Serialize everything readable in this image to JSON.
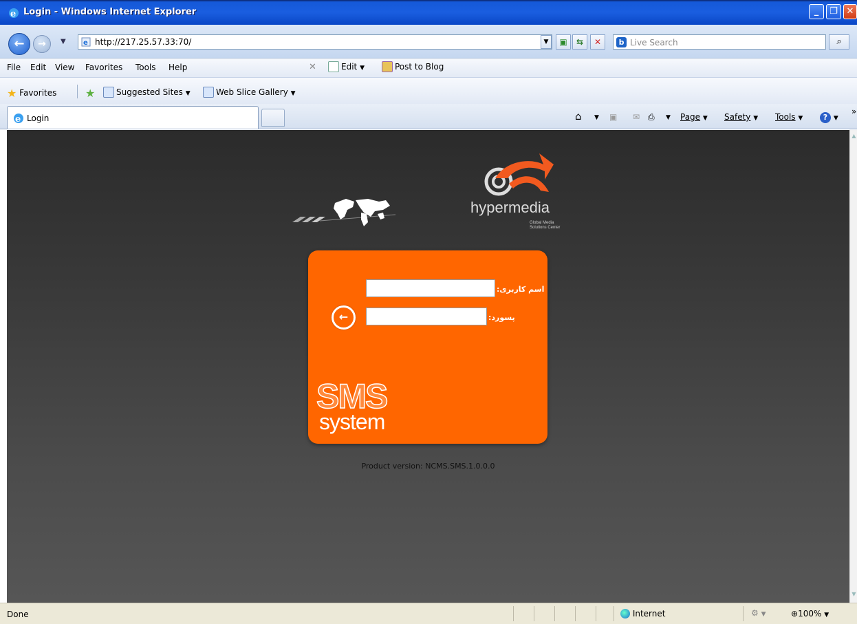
{
  "window": {
    "title": "Login - Windows Internet Explorer"
  },
  "address": {
    "url": "http://217.25.57.33:70/",
    "search_placeholder": "Live Search"
  },
  "menu": {
    "file": "File",
    "edit": "Edit",
    "view": "View",
    "favorites": "Favorites",
    "tools": "Tools",
    "help": "Help",
    "edit_btn": "Edit",
    "post_to_blog": "Post to Blog"
  },
  "favorites_bar": {
    "favorites": "Favorites",
    "suggested_sites": "Suggested Sites",
    "web_slice_gallery": "Web Slice Gallery"
  },
  "tabs": {
    "active_title": "Login"
  },
  "commandbar": {
    "page": "Page",
    "safety": "Safety",
    "tools": "Tools"
  },
  "login": {
    "username_label": "اسم کاربری:",
    "password_label": "پسورد:",
    "username_value": "",
    "password_value": "",
    "logo_sms": "SMS",
    "logo_system": "system",
    "brand": "hypermedia",
    "brand_tagline_1": "Global Media",
    "brand_tagline_2": "Solutions Center"
  },
  "version": "Product version: NCMS.SMS.1.0.0.0",
  "status": {
    "left": "Done",
    "zone": "Internet",
    "zoom": "100%"
  },
  "colors": {
    "accent": "#ff6600",
    "background": "#3a3a3a"
  }
}
